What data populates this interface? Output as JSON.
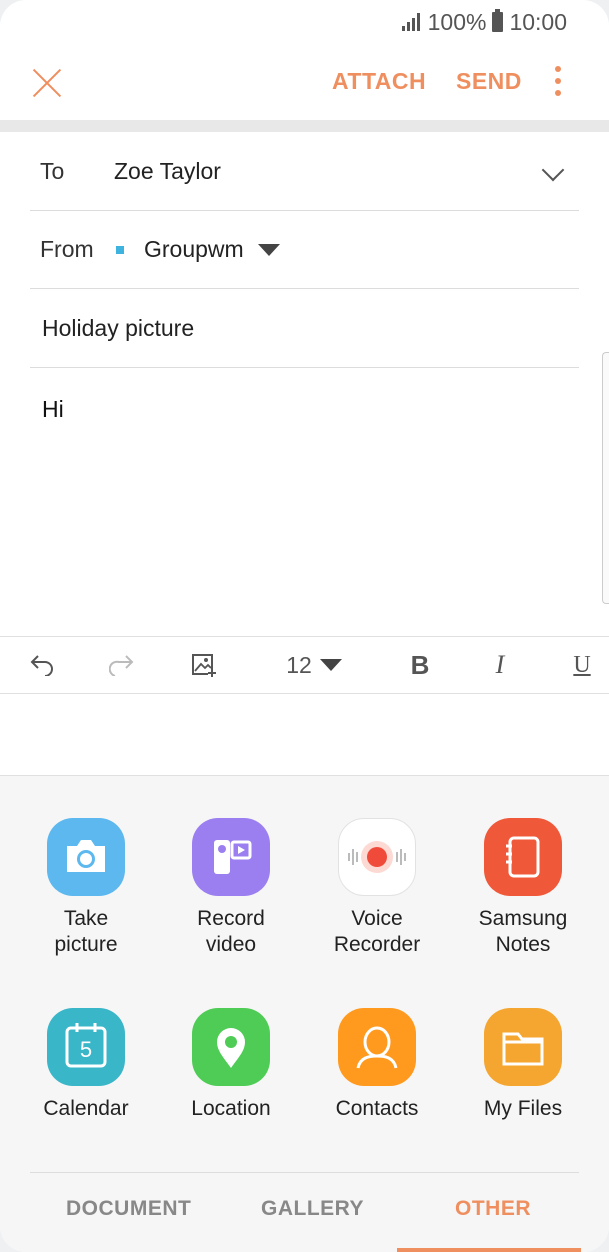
{
  "status_bar": {
    "battery": "100%",
    "time": "10:00"
  },
  "appbar": {
    "attach_label": "ATTACH",
    "send_label": "SEND"
  },
  "compose": {
    "to_label": "To",
    "to_value": "Zoe Taylor",
    "from_label": "From",
    "from_value": "Groupwm",
    "subject": "Holiday picture",
    "body": "Hi"
  },
  "toolbar": {
    "font_size": "12",
    "bold": "B",
    "italic": "I",
    "underline": "U"
  },
  "attach_options": [
    {
      "label": "Take picture",
      "icon": "camera-icon",
      "color": "#5cb8ee"
    },
    {
      "label": "Record video",
      "icon": "video-camera-icon",
      "color": "#9b7ff0"
    },
    {
      "label": "Voice Recorder",
      "icon": "voice-recorder-icon",
      "color": "#ffffff"
    },
    {
      "label": "Samsung Notes",
      "icon": "notes-icon",
      "color": "#f0583a"
    },
    {
      "label": "Calendar",
      "icon": "calendar-icon",
      "color": "#3ab6c9",
      "badge": "5"
    },
    {
      "label": "Location",
      "icon": "location-pin-icon",
      "color": "#4fcc55"
    },
    {
      "label": "Contacts",
      "icon": "contacts-icon",
      "color": "#ff9a1f"
    },
    {
      "label": "My Files",
      "icon": "folder-icon",
      "color": "#f4a630"
    }
  ],
  "tabs": [
    {
      "label": "DOCUMENT",
      "active": false
    },
    {
      "label": "GALLERY",
      "active": false
    },
    {
      "label": "OTHER",
      "active": true
    }
  ],
  "colors": {
    "accent": "#ef8f5f"
  }
}
